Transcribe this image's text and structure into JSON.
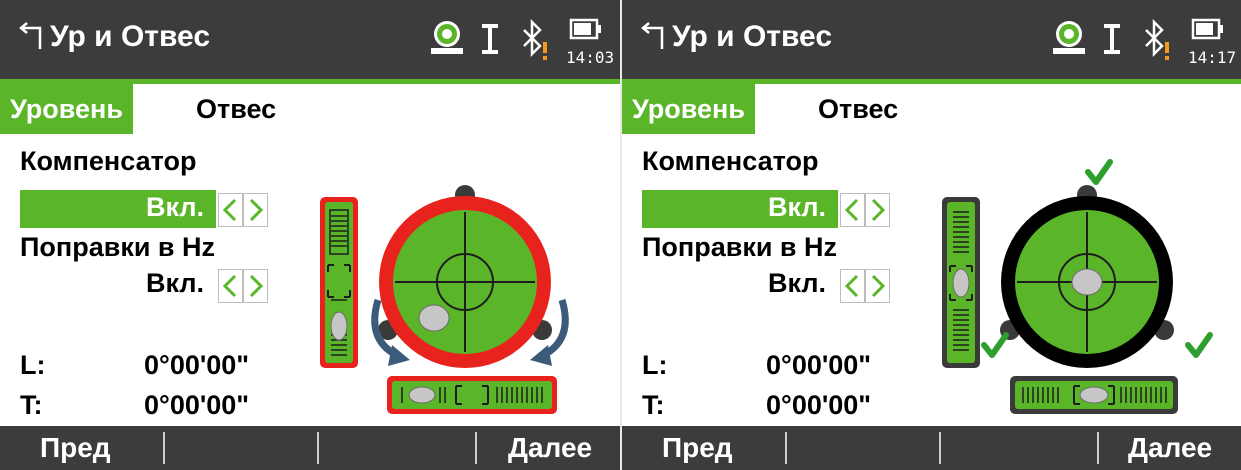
{
  "screens": [
    {
      "title": "Ур и Отвес",
      "time": "14:03",
      "tabs": [
        {
          "label": "Уровень",
          "active": true
        },
        {
          "label": "Отвес",
          "active": false
        }
      ],
      "compensator": {
        "label": "Компенсатор",
        "value": "Вкл."
      },
      "hz_corrections": {
        "label": "Поправки в Hz",
        "value": "Вкл."
      },
      "tilt_l": {
        "label": "L:",
        "value": "0°00'00\""
      },
      "tilt_t": {
        "label": "T:",
        "value": "0°00'00\""
      },
      "softkeys": [
        "Пред",
        "",
        "",
        "Далее"
      ],
      "level_state": "not-leveled",
      "ring_color": "#e8231e"
    },
    {
      "title": "Ур и Отвес",
      "time": "14:17",
      "tabs": [
        {
          "label": "Уровень",
          "active": true
        },
        {
          "label": "Отвес",
          "active": false
        }
      ],
      "compensator": {
        "label": "Компенсатор",
        "value": "Вкл."
      },
      "hz_corrections": {
        "label": "Поправки в Hz",
        "value": "Вкл."
      },
      "tilt_l": {
        "label": "L:",
        "value": "0°00'00\""
      },
      "tilt_t": {
        "label": "T:",
        "value": "0°00'00\""
      },
      "softkeys": [
        "Пред",
        "",
        "",
        "Далее"
      ],
      "level_state": "leveled",
      "ring_color": "#000000"
    }
  ],
  "icons": [
    "back-icon",
    "level-bubble-icon",
    "reflectorless-target-icon",
    "bluetooth-warning-icon",
    "battery-icon",
    "left-arrow-icon",
    "right-arrow-icon",
    "check-icon",
    "rotate-arrow-icon"
  ],
  "colors": {
    "accent": "#5bb529",
    "bar": "#3c3c3c",
    "warning": "#e8231e",
    "check": "#2e9e2e"
  }
}
